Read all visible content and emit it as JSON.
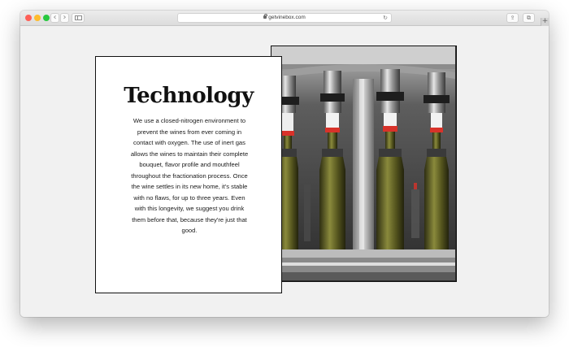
{
  "browser": {
    "url": "getvinebox.com",
    "back_glyph": "‹",
    "forward_glyph": "›",
    "reload_glyph": "↻",
    "share_glyph": "⇪",
    "tabs_glyph": "⧉",
    "newtab_glyph": "+",
    "colors": {
      "close": "#fe5f57",
      "minimize": "#febc2e",
      "zoom": "#28c840"
    }
  },
  "section": {
    "title": "Technology",
    "body": "We use a closed-nitrogen environment to prevent the wines from ever coming in contact with oxygen. The use of inert gas allows the wines to maintain their complete bouquet, flavor profile and mouthfeel throughout the fractionation process. Once the wine settles in its new home, it's stable with no flaws, for up to three years. Even with this longevity, we suggest you drink them before that, because they're just that good."
  },
  "photo": {
    "subject": "wine-bottling-machine",
    "accent_color": "#d8322a",
    "wine_color": "#5a5a1e"
  }
}
